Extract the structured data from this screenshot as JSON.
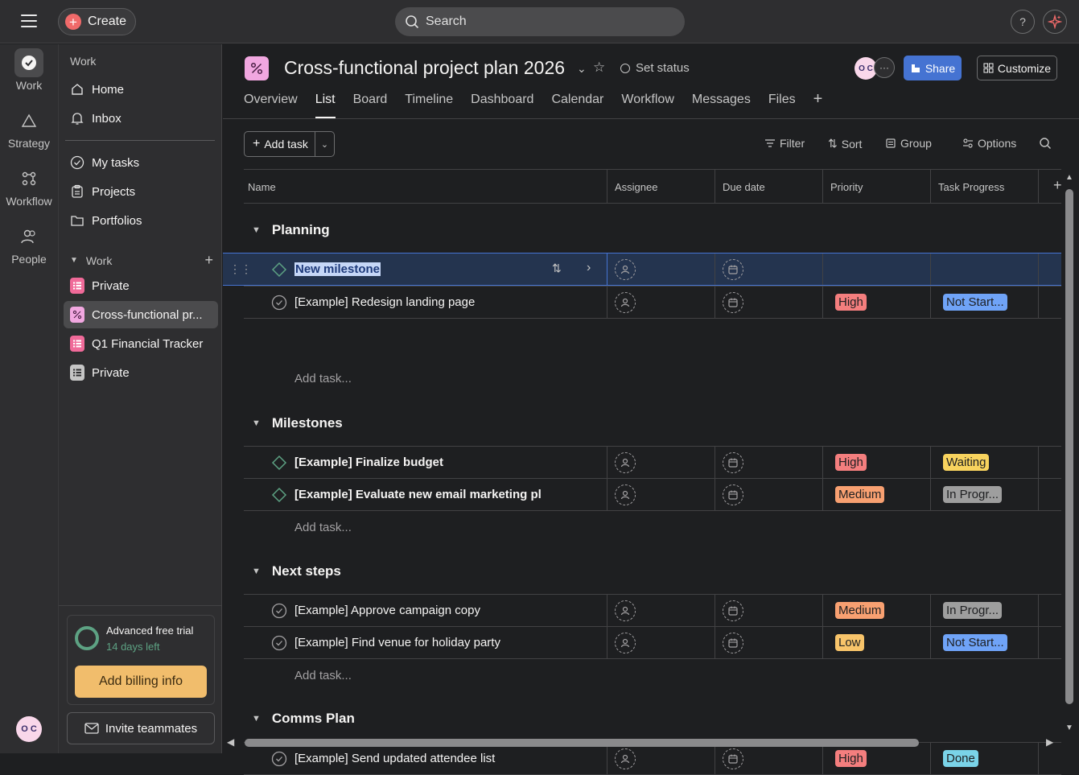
{
  "topbar": {
    "create_label": "Create",
    "search_placeholder": "Search",
    "help_label": "?"
  },
  "rail": {
    "items": [
      {
        "label": "Work",
        "icon": "check-circle-icon"
      },
      {
        "label": "Strategy",
        "icon": "triangle-icon"
      },
      {
        "label": "Workflow",
        "icon": "workflow-icon"
      },
      {
        "label": "People",
        "icon": "people-icon"
      }
    ],
    "avatar_initials": "O C"
  },
  "sidebar": {
    "heading": "Work",
    "nav": [
      {
        "label": "Home",
        "icon": "home-icon"
      },
      {
        "label": "Inbox",
        "icon": "bell-icon"
      },
      {
        "label": "My tasks",
        "icon": "check-circle-icon"
      },
      {
        "label": "Projects",
        "icon": "clipboard-icon"
      },
      {
        "label": "Portfolios",
        "icon": "folder-icon"
      }
    ],
    "section_label": "Work",
    "projects": [
      {
        "label": "Private",
        "color": "#f06a99"
      },
      {
        "label": "Cross-functional pr...",
        "color": "#f1a7e0"
      },
      {
        "label": "Q1 Financial Tracker",
        "color": "#f06a99"
      },
      {
        "label": "Private",
        "color": "#c5c5c5"
      }
    ],
    "trial": {
      "title": "Advanced free trial",
      "subtitle": "14 days left",
      "billing_label": "Add billing info"
    },
    "invite_label": "Invite teammates"
  },
  "project": {
    "title": "Cross-functional project plan 2026",
    "set_status_label": "Set status",
    "avatar_initials": "O C",
    "more_label": "···",
    "share_label": "Share",
    "customize_label": "Customize",
    "tabs": [
      "Overview",
      "List",
      "Board",
      "Timeline",
      "Dashboard",
      "Calendar",
      "Workflow",
      "Messages",
      "Files"
    ],
    "active_tab": "List"
  },
  "toolbar": {
    "add_task_label": "Add task",
    "filter_label": "Filter",
    "sort_label": "Sort",
    "group_label": "Group",
    "options_label": "Options"
  },
  "columns": {
    "name": "Name",
    "assignee": "Assignee",
    "due_date": "Due date",
    "priority": "Priority",
    "task_progress": "Task Progress"
  },
  "add_task_row_label": "Add task...",
  "colors": {
    "high": "#f47e7e",
    "medium": "#f8a071",
    "low": "#f8c46a",
    "not_started": "#6fa3f7",
    "waiting": "#f8d35e",
    "in_progress": "#9e9e9e",
    "done": "#7ad3e8"
  },
  "sections": [
    {
      "name": "Planning",
      "tasks": [
        {
          "name": "New milestone",
          "type": "milestone",
          "priority": "",
          "progress": ""
        },
        {
          "name": "[Example] Redesign landing page",
          "type": "task",
          "priority": "High",
          "progress": "Not Start..."
        }
      ]
    },
    {
      "name": "Milestones",
      "tasks": [
        {
          "name": "[Example] Finalize budget",
          "type": "milestone",
          "priority": "High",
          "progress": "Waiting"
        },
        {
          "name": "[Example] Evaluate new email marketing pl",
          "type": "milestone",
          "priority": "Medium",
          "progress": "In Progr..."
        }
      ]
    },
    {
      "name": "Next steps",
      "tasks": [
        {
          "name": "[Example] Approve campaign copy",
          "type": "task",
          "priority": "Medium",
          "progress": "In Progr..."
        },
        {
          "name": "[Example] Find venue for holiday party",
          "type": "task",
          "priority": "Low",
          "progress": "Not Start..."
        }
      ]
    },
    {
      "name": "Comms Plan",
      "tasks": [
        {
          "name": "[Example] Send updated attendee list",
          "type": "task",
          "priority": "High",
          "progress": "Done"
        }
      ]
    }
  ]
}
